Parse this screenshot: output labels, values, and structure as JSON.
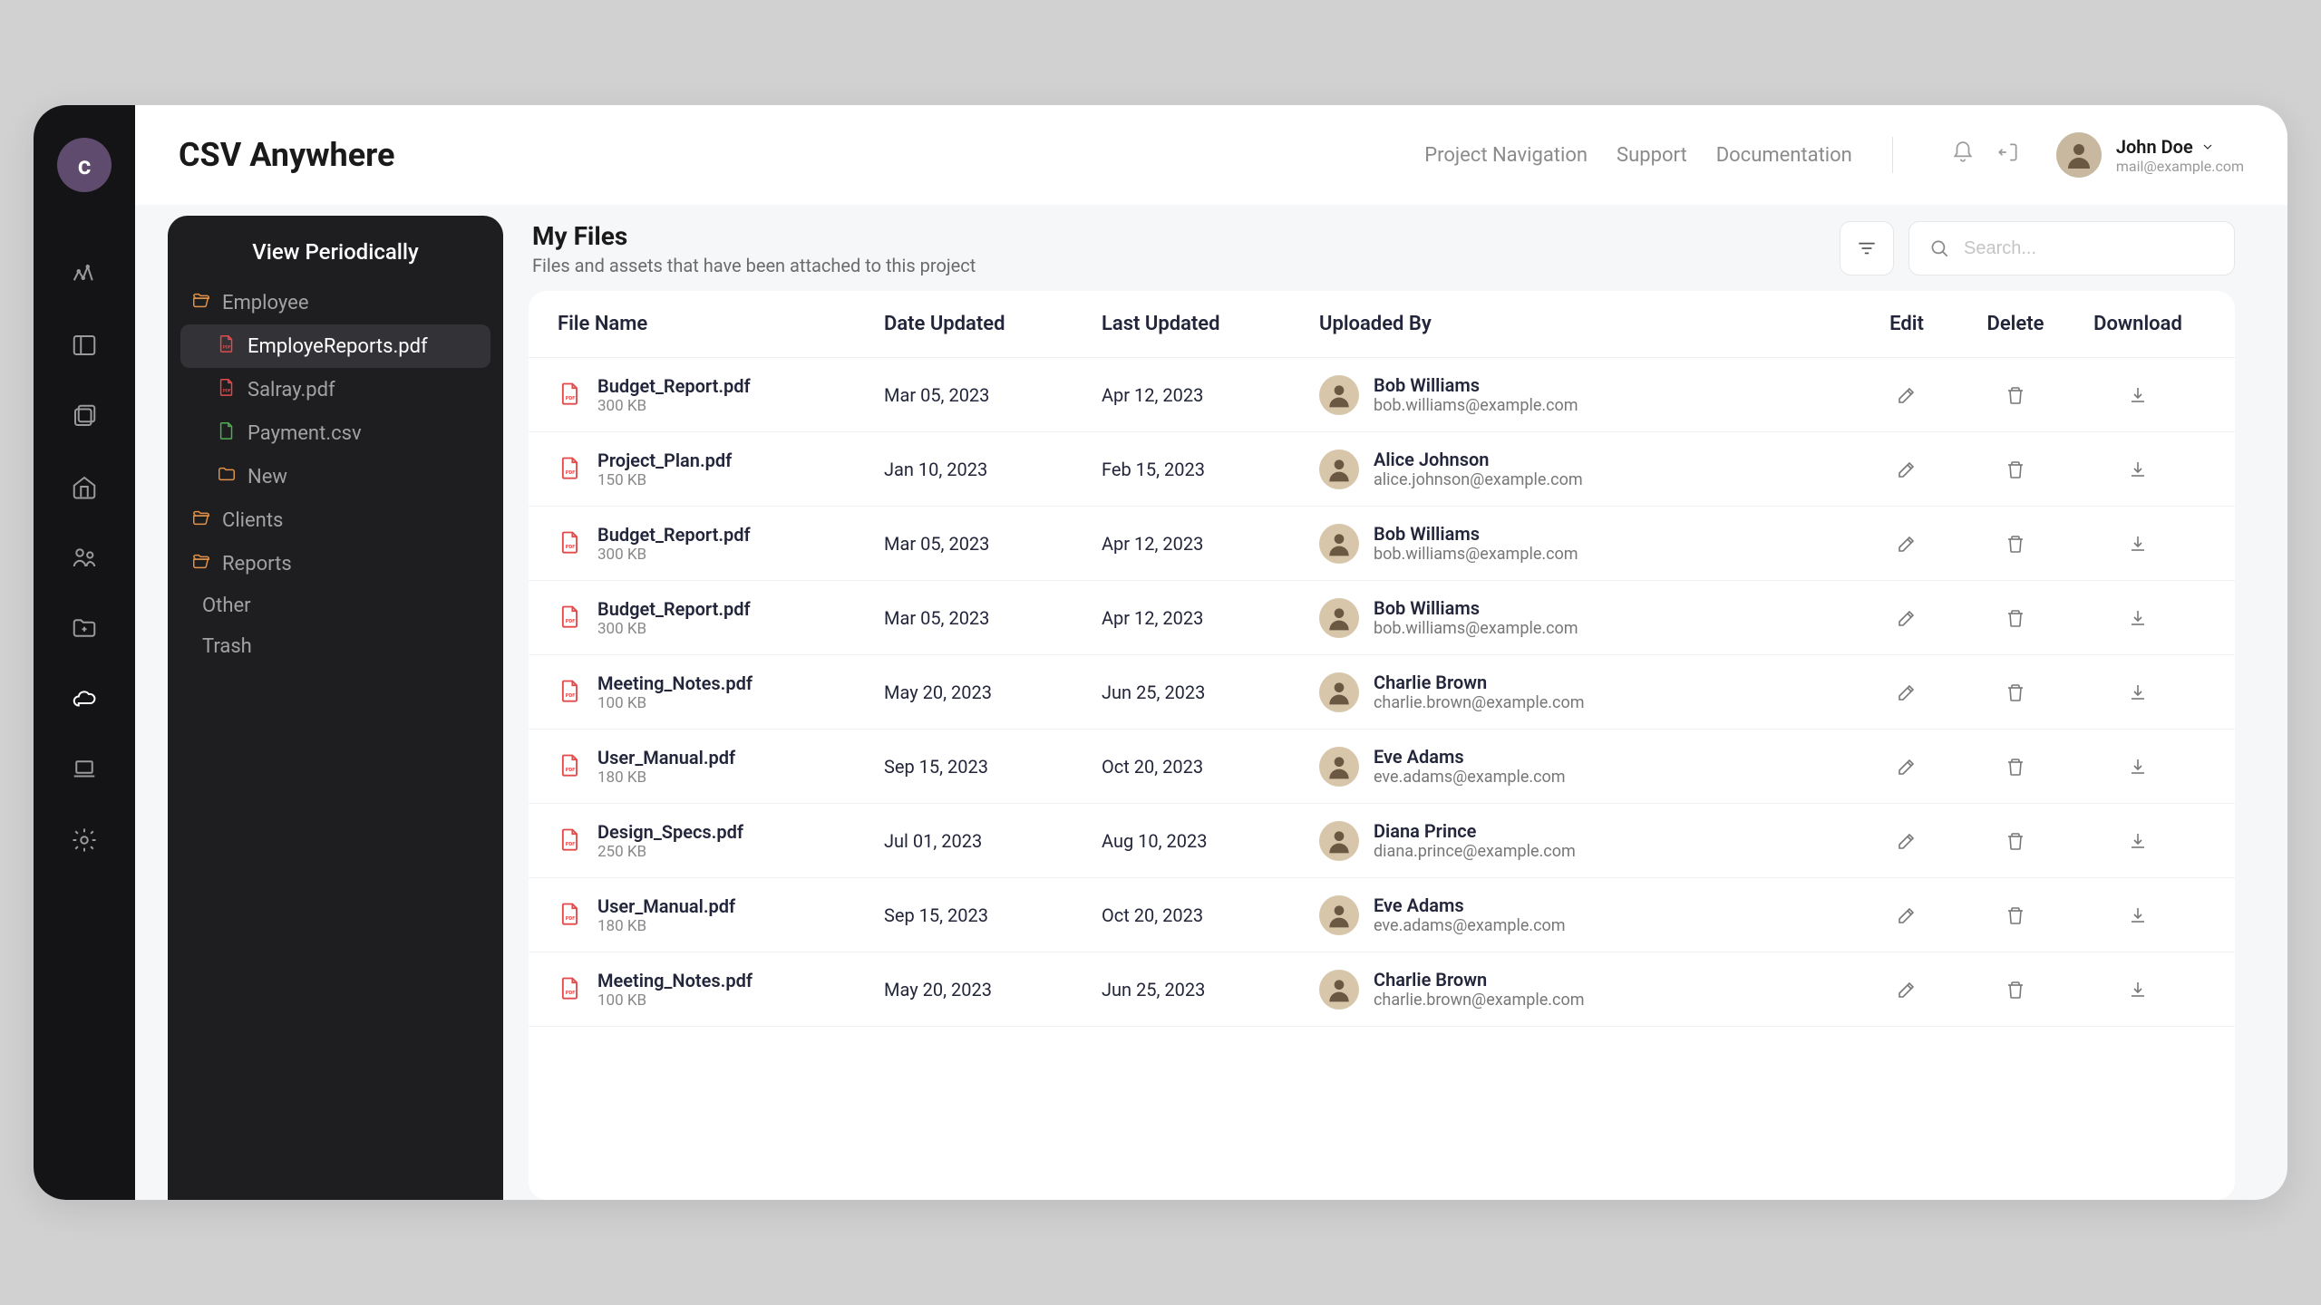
{
  "app": {
    "title": "CSV Anywhere",
    "logo_letter": "c"
  },
  "header": {
    "links": [
      "Project Navigation",
      "Support",
      "Documentation"
    ],
    "user": {
      "name": "John Doe",
      "email": "mail@example.com"
    },
    "search_placeholder": "Search..."
  },
  "tree": {
    "title": "View Periodically",
    "items": [
      {
        "label": "Employee",
        "kind": "folder",
        "depth": 0
      },
      {
        "label": "EmployeReports.pdf",
        "kind": "pdf",
        "depth": 1,
        "selected": true
      },
      {
        "label": "Salray.pdf",
        "kind": "pdf",
        "depth": 1
      },
      {
        "label": "Payment.csv",
        "kind": "csv",
        "depth": 1
      },
      {
        "label": "New",
        "kind": "folder",
        "depth": 1
      },
      {
        "label": "Clients",
        "kind": "folder",
        "depth": 0
      },
      {
        "label": "Reports",
        "kind": "folder",
        "depth": 0
      },
      {
        "label": "Other",
        "kind": "chevron",
        "depth": 0
      },
      {
        "label": "Trash",
        "kind": "trash",
        "depth": 0
      }
    ]
  },
  "files": {
    "heading": "My Files",
    "subheading": "Files and assets that have been attached to this project",
    "columns": {
      "name": "File Name",
      "date": "Date Updated",
      "last": "Last Updated",
      "by": "Uploaded By",
      "edit": "Edit",
      "delete": "Delete",
      "download": "Download"
    },
    "rows": [
      {
        "name": "Budget_Report.pdf",
        "size": "300 KB",
        "date": "Mar 05, 2023",
        "last": "Apr 12, 2023",
        "by_name": "Bob Williams",
        "by_email": "bob.williams@example.com"
      },
      {
        "name": "Project_Plan.pdf",
        "size": "150 KB",
        "date": "Jan 10, 2023",
        "last": "Feb 15, 2023",
        "by_name": "Alice Johnson",
        "by_email": "alice.johnson@example.com"
      },
      {
        "name": "Budget_Report.pdf",
        "size": "300 KB",
        "date": "Mar 05, 2023",
        "last": "Apr 12, 2023",
        "by_name": "Bob Williams",
        "by_email": "bob.williams@example.com"
      },
      {
        "name": "Budget_Report.pdf",
        "size": "300 KB",
        "date": "Mar 05, 2023",
        "last": "Apr 12, 2023",
        "by_name": "Bob Williams",
        "by_email": "bob.williams@example.com"
      },
      {
        "name": "Meeting_Notes.pdf",
        "size": "100 KB",
        "date": "May 20, 2023",
        "last": "Jun 25, 2023",
        "by_name": "Charlie Brown",
        "by_email": "charlie.brown@example.com"
      },
      {
        "name": "User_Manual.pdf",
        "size": "180 KB",
        "date": "Sep 15, 2023",
        "last": "Oct 20, 2023",
        "by_name": "Eve Adams",
        "by_email": "eve.adams@example.com"
      },
      {
        "name": "Design_Specs.pdf",
        "size": "250 KB",
        "date": "Jul 01, 2023",
        "last": "Aug 10, 2023",
        "by_name": "Diana Prince",
        "by_email": "diana.prince@example.com"
      },
      {
        "name": "User_Manual.pdf",
        "size": "180 KB",
        "date": "Sep 15, 2023",
        "last": "Oct 20, 2023",
        "by_name": "Eve Adams",
        "by_email": "eve.adams@example.com"
      },
      {
        "name": "Meeting_Notes.pdf",
        "size": "100 KB",
        "date": "May 20, 2023",
        "last": "Jun 25, 2023",
        "by_name": "Charlie Brown",
        "by_email": "charlie.brown@example.com"
      }
    ]
  }
}
